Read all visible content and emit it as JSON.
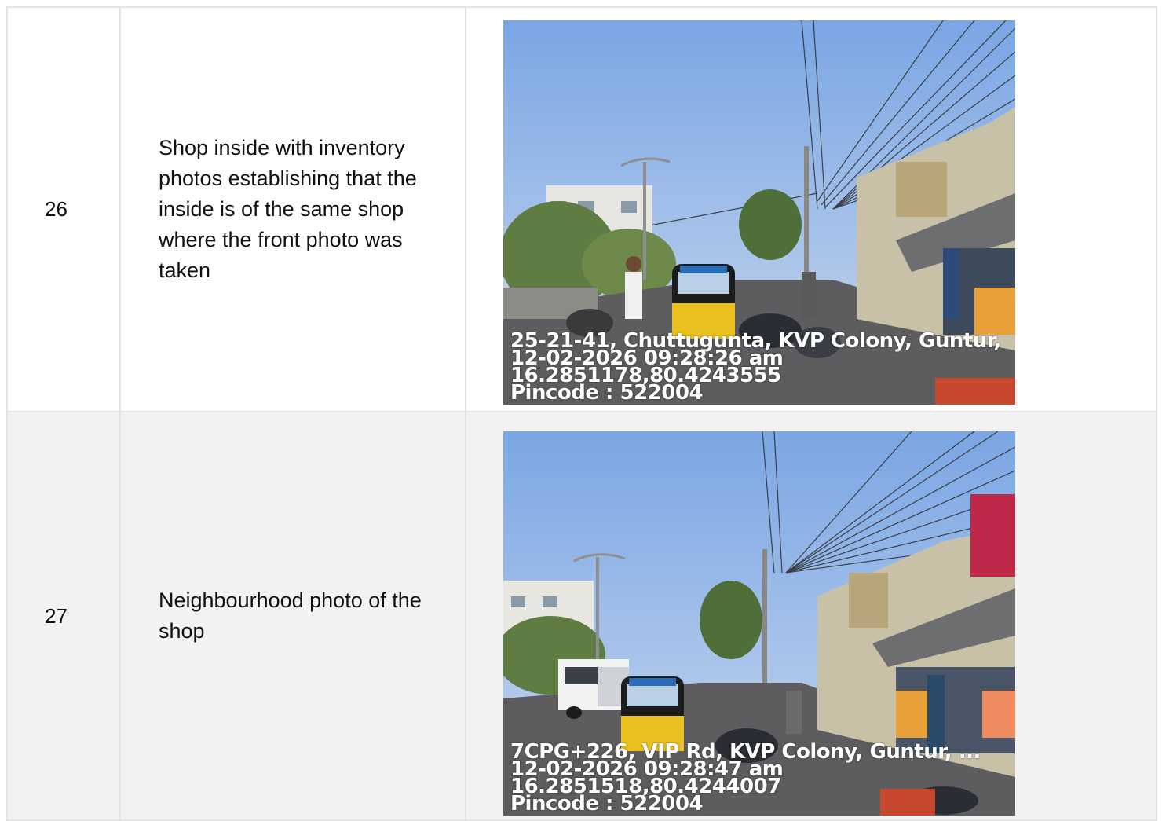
{
  "rows": [
    {
      "number": "26",
      "description": "Shop inside with inventory photos establishing that the inside is of the same shop where the front photo was taken",
      "photo": {
        "caption": "Street view with auto-rickshaws, people and roadside shops",
        "stamp_lines": [
          "25-21-41, Chuttugunta, KVP Colony, Guntur,",
          "12-02-2026 09:28:26 am",
          "16.2851178,80.4243555",
          "Pincode : 522004"
        ]
      }
    },
    {
      "number": "27",
      "description": "Neighbourhood photo of the shop",
      "photo": {
        "caption": "Street view with truck, auto-rickshaw and shop fronts",
        "stamp_lines": [
          "7CPG+226, VIP Rd, KVP Colony, Guntur, ...",
          "12-02-2026 09:28:47 am",
          "16.2851518,80.4244007",
          "Pincode : 522004"
        ]
      }
    }
  ]
}
